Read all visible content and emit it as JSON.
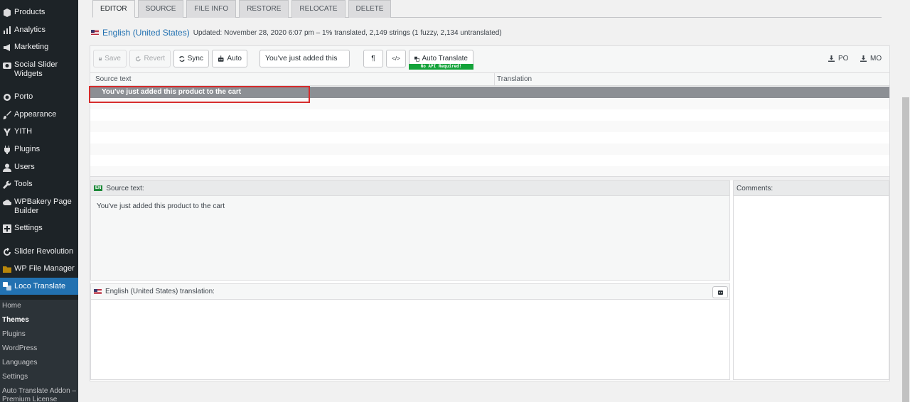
{
  "sidebar": {
    "items": [
      {
        "label": "Products",
        "icon": "cube-icon"
      },
      {
        "label": "Analytics",
        "icon": "bar-chart-icon"
      },
      {
        "label": "Marketing",
        "icon": "megaphone-icon"
      },
      {
        "label": "Social Slider Widgets",
        "icon": "camera-icon"
      },
      {
        "label": "Porto",
        "icon": "circle-icon"
      },
      {
        "label": "Appearance",
        "icon": "brush-icon"
      },
      {
        "label": "YITH",
        "icon": "yith-icon"
      },
      {
        "label": "Plugins",
        "icon": "plug-icon"
      },
      {
        "label": "Users",
        "icon": "user-icon"
      },
      {
        "label": "Tools",
        "icon": "wrench-icon"
      },
      {
        "label": "WPBakery Page Builder",
        "icon": "cloud-icon"
      },
      {
        "label": "Settings",
        "icon": "settings-icon"
      },
      {
        "label": "Slider Revolution",
        "icon": "refresh-icon"
      },
      {
        "label": "WP File Manager",
        "icon": "folder-icon"
      },
      {
        "label": "Loco Translate",
        "icon": "translate-icon"
      }
    ],
    "submenu": [
      "Home",
      "Themes",
      "Plugins",
      "WordPress",
      "Languages",
      "Settings",
      "Auto Translate Addon – Premium License"
    ],
    "active_submenu": "Themes"
  },
  "tabs": [
    "EDITOR",
    "SOURCE",
    "FILE INFO",
    "RESTORE",
    "RELOCATE",
    "DELETE"
  ],
  "status": {
    "language": "English (United States)",
    "text": "Updated: November 28, 2020 6:07 pm – 1% translated, 2,149 strings (1 fuzzy, 2,134 untranslated)"
  },
  "toolbar": {
    "save": "Save",
    "revert": "Revert",
    "sync": "Sync",
    "auto": "Auto",
    "search_value": "You've just added this",
    "pilcrow": "¶",
    "code": "</>",
    "auto_translate": "Auto Translate",
    "badge": "No API Required!",
    "po": "PO",
    "mo": "MO"
  },
  "columns": {
    "source": "Source text",
    "translation": "Translation"
  },
  "selected_row": "You've just added this product to the cart",
  "source_pane": {
    "lang_badge": "EN",
    "heading": "Source text:",
    "text": "You've just added this product to the cart"
  },
  "comments_heading": "Comments:",
  "translation_heading": "English (United States) translation:"
}
